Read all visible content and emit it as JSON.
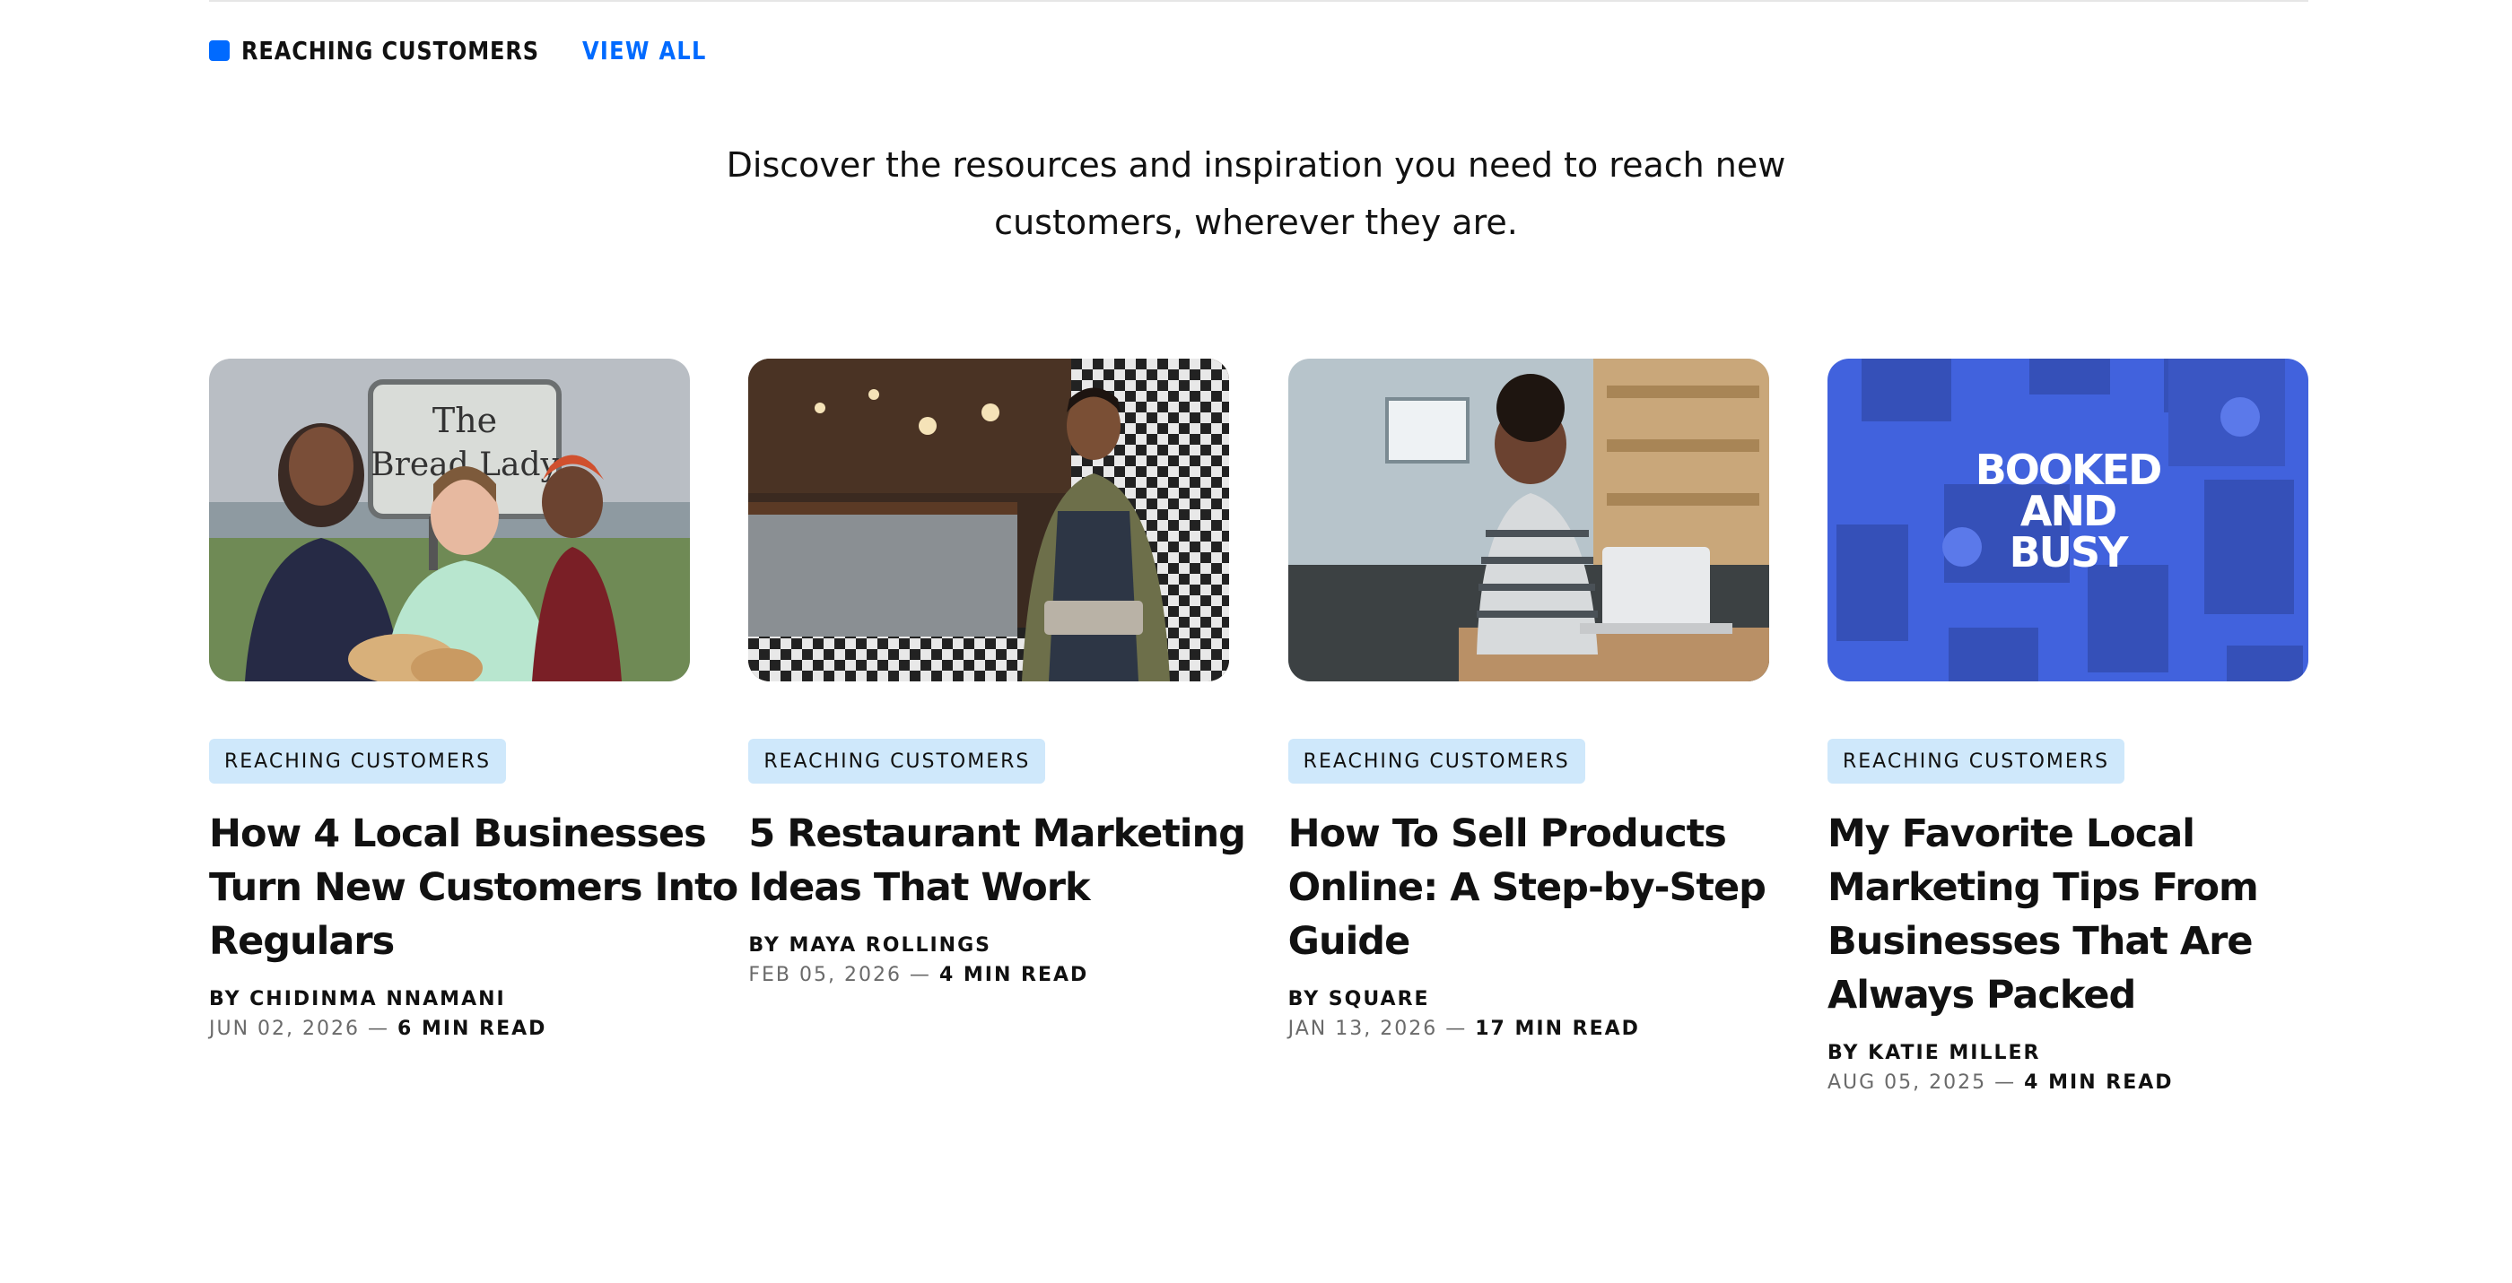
{
  "section": {
    "title": "REACHING CUSTOMERS",
    "view_all": "VIEW ALL",
    "intro_line1": "Discover the resources and inspiration you need to reach new",
    "intro_line2": "customers, wherever they are."
  },
  "colors": {
    "accent": "#006aff",
    "tag_bg": "#cfe8fb",
    "text": "#111111",
    "muted": "#6a6a6a"
  },
  "cards": [
    {
      "image": "bread-lady-photo",
      "image_text": [
        "The",
        "Bread Lady"
      ],
      "tag": "REACHING CUSTOMERS",
      "title_lines": [
        "How 4 Local Businesses",
        "Turn New Customers Into",
        "Regulars"
      ],
      "byline": "BY CHIDINMA NNAMANI",
      "date": "JUN 02, 2026",
      "separator": " — ",
      "read_time": "6 MIN READ"
    },
    {
      "image": "restaurant-owner-photo",
      "tag": "REACHING CUSTOMERS",
      "title_lines": [
        "5 Restaurant Marketing",
        "Ideas That Work"
      ],
      "byline": "BY MAYA ROLLINGS",
      "date": "FEB 05, 2026",
      "separator": " — ",
      "read_time": "4 MIN READ"
    },
    {
      "image": "online-shopper-photo",
      "tag": "REACHING CUSTOMERS",
      "title_lines": [
        "How To Sell Products",
        "Online: A Step-by-Step",
        "Guide"
      ],
      "byline": "BY SQUARE",
      "date": "JAN 13, 2026",
      "separator": " — ",
      "read_time": "17 MIN READ"
    },
    {
      "image": "booked-and-busy-collage",
      "image_text": [
        "BOOKED",
        "AND",
        "BUSY"
      ],
      "tag": "REACHING CUSTOMERS",
      "title_lines": [
        "My Favorite Local",
        "Marketing Tips From",
        "Businesses That Are",
        "Always Packed"
      ],
      "byline": "BY KATIE MILLER",
      "date": "AUG 05, 2025",
      "separator": " — ",
      "read_time": "4 MIN READ"
    }
  ]
}
